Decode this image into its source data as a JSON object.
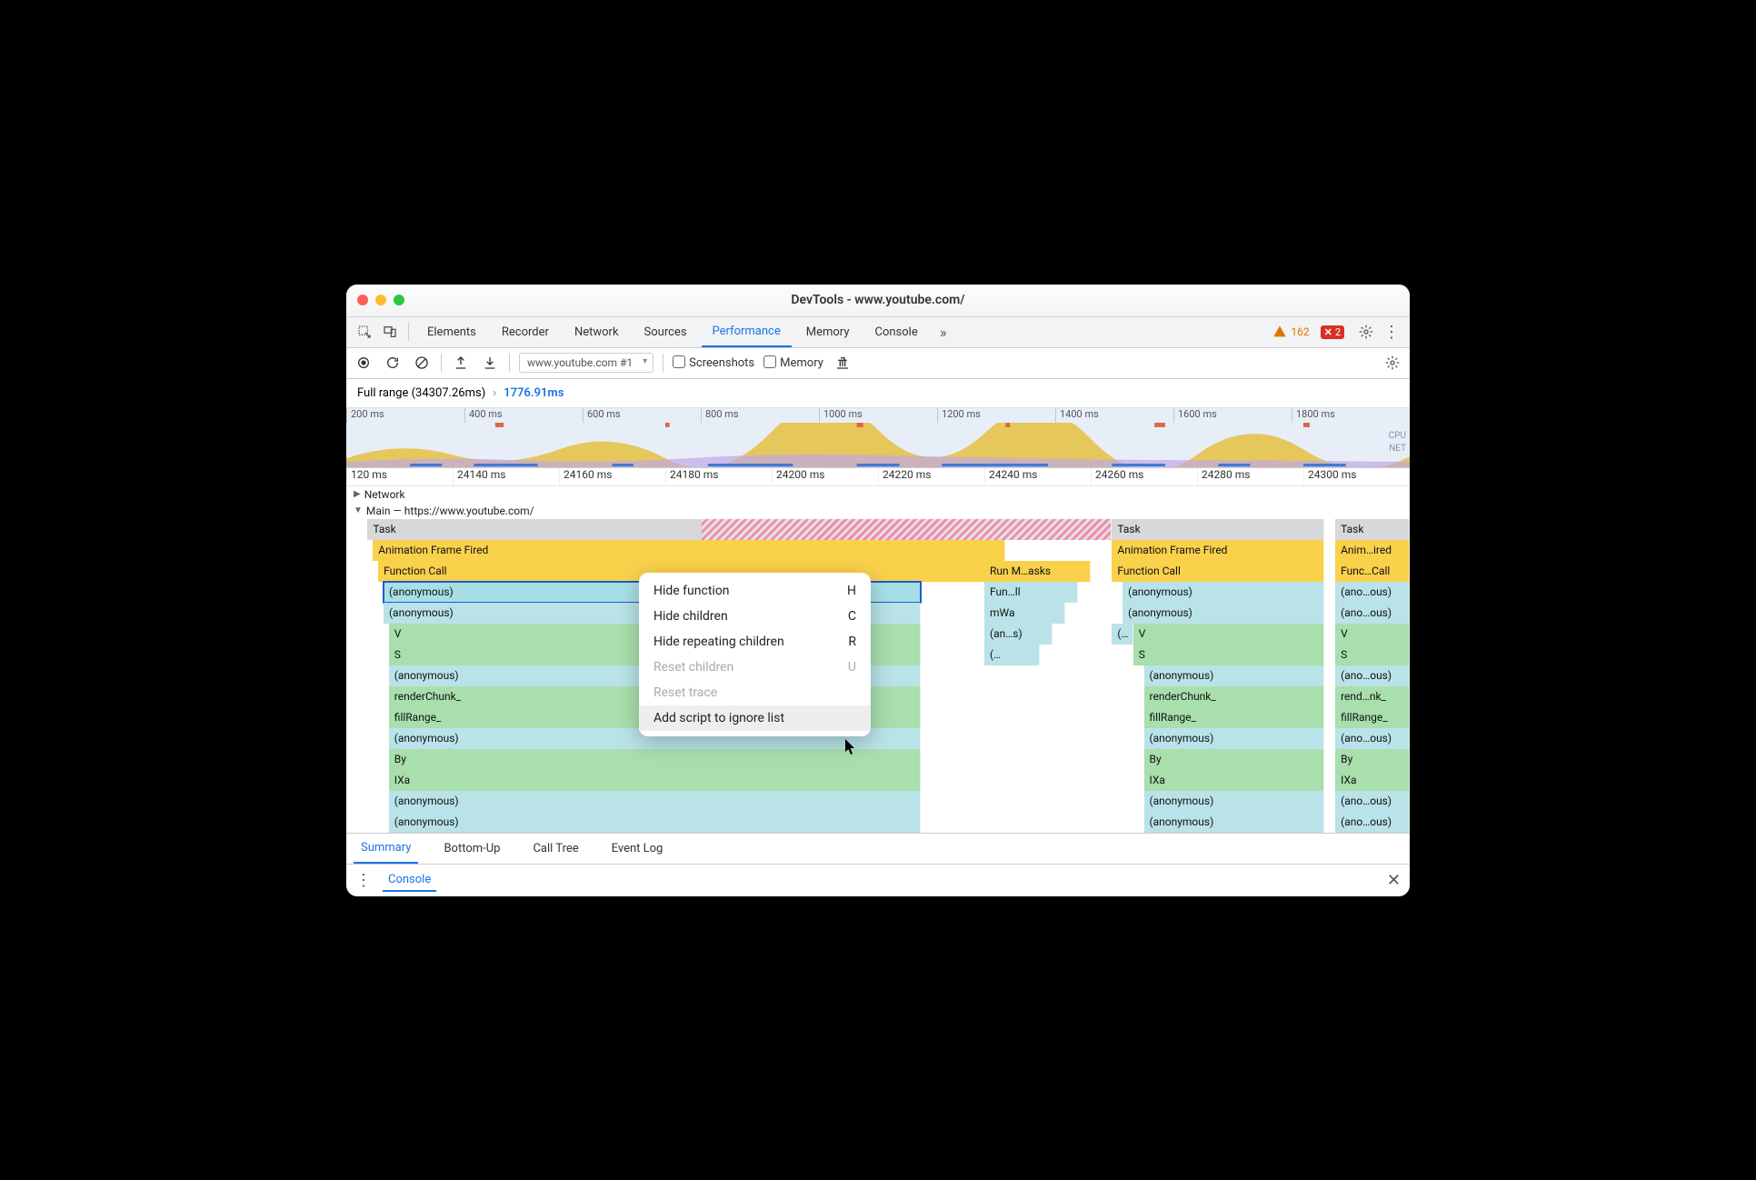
{
  "window_title": "DevTools - www.youtube.com/",
  "main_tabs": [
    "Elements",
    "Recorder",
    "Network",
    "Sources",
    "Performance",
    "Memory",
    "Console"
  ],
  "active_main_tab": "Performance",
  "warning_count": "162",
  "error_count": "2",
  "toolbar": {
    "recording_select": "www.youtube.com #1",
    "screenshots_label": "Screenshots",
    "memory_label": "Memory"
  },
  "range": {
    "full_label": "Full range (34307.26ms)",
    "chevron": "›",
    "current": "1776.91ms"
  },
  "overview_ticks": [
    "200 ms",
    "400 ms",
    "600 ms",
    "800 ms",
    "1000 ms",
    "1200 ms",
    "1400 ms",
    "1600 ms",
    "1800 ms"
  ],
  "overview_labels": {
    "cpu": "CPU",
    "net": "NET"
  },
  "ruler_ticks": [
    "120 ms",
    "24140 ms",
    "24160 ms",
    "24180 ms",
    "24200 ms",
    "24220 ms",
    "24240 ms",
    "24260 ms",
    "24280 ms",
    "24300 ms"
  ],
  "tracks": {
    "network_label": "Network",
    "main_label": "Main — https://www.youtube.com/"
  },
  "flame": {
    "col1": [
      "Task",
      "Animation Frame Fired",
      "Function Call",
      "(anonymous)",
      "(anonymous)",
      "V",
      "S",
      "(anonymous)",
      "renderChunk_",
      "fillRange_",
      "(anonymous)",
      "By",
      "IXa",
      "(anonymous)",
      "(anonymous)"
    ],
    "col1_side": [
      "Run M…asks",
      "Fun…ll",
      "mWa",
      "(an…s)",
      "(…"
    ],
    "col2": [
      "Task",
      "Animation Frame Fired",
      "Function Call",
      "(anonymous)",
      "(anonymous)",
      "V",
      "S",
      "(anonymous)",
      "renderChunk_",
      "fillRange_",
      "(anonymous)",
      "By",
      "IXa",
      "(anonymous)",
      "(anonymous)"
    ],
    "col2_prefix": "(…",
    "col3": [
      "Task",
      "Anim…ired",
      "Func…Call",
      "(ano…ous)",
      "(ano…ous)",
      "V",
      "S",
      "(ano…ous)",
      "rend…nk_",
      "fillRange_",
      "(ano…ous)",
      "By",
      "IXa",
      "(ano…ous)",
      "(ano…ous)"
    ]
  },
  "context_menu": [
    {
      "label": "Hide function",
      "shortcut": "H",
      "disabled": false
    },
    {
      "label": "Hide children",
      "shortcut": "C",
      "disabled": false
    },
    {
      "label": "Hide repeating children",
      "shortcut": "R",
      "disabled": false
    },
    {
      "label": "Reset children",
      "shortcut": "U",
      "disabled": true
    },
    {
      "label": "Reset trace",
      "shortcut": "",
      "disabled": true
    },
    {
      "label": "Add script to ignore list",
      "shortcut": "",
      "disabled": false
    }
  ],
  "bottom_tabs": [
    "Summary",
    "Bottom-Up",
    "Call Tree",
    "Event Log"
  ],
  "active_bottom_tab": "Summary",
  "drawer_label": "Console"
}
